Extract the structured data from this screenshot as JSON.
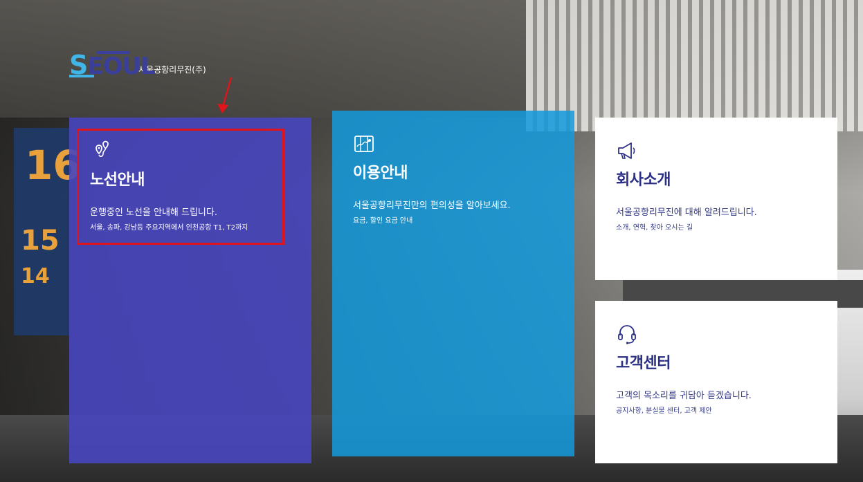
{
  "logo": {
    "letter_s": "S",
    "word_rest": "EOUL",
    "company_name": "서울공항리무진(주)"
  },
  "background": {
    "pillar_numbers": [
      "16",
      "15",
      "14"
    ]
  },
  "cards": {
    "route": {
      "title": "노선안내",
      "description": "운행중인 노선을 안내해 드립니다.",
      "sub": "서울, 송파, 강남등 주요지역에서 인천공항 T1, T2까지",
      "icon": "route-pin-icon",
      "color": "#4746be"
    },
    "usage": {
      "title": "이용안내",
      "description": "서울공항리무진만의 편의성을 알아보세요.",
      "sub": "요금, 할인 요금 안내",
      "icon": "map-icon",
      "color": "#149adc"
    },
    "company": {
      "title": "회사소개",
      "description": "서울공항리무진에 대해 알려드립니다.",
      "sub": "소개, 연혁, 찾아 오시는 길",
      "icon": "megaphone-icon",
      "color": "#ffffff"
    },
    "center": {
      "title": "고객센터",
      "description": "고객의 목소리를 귀담아 듣겠습니다.",
      "sub": "공지사항, 분실물 센터, 고객 제안",
      "icon": "headset-icon",
      "color": "#ffffff"
    }
  },
  "annotation": {
    "highlight_color": "#e0141a",
    "arrow_color": "#e0141a"
  }
}
